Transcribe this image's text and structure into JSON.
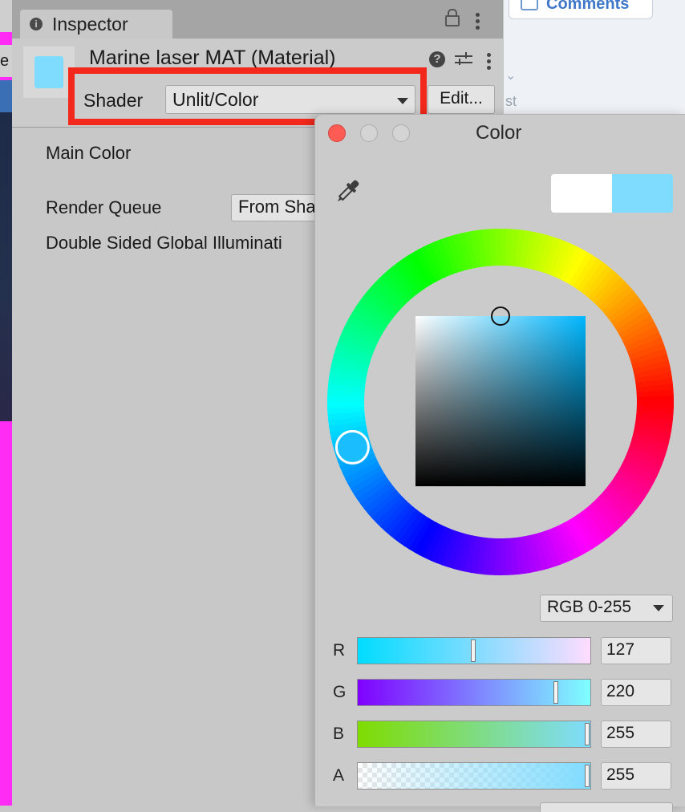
{
  "background_app": {
    "comments_label": "Comments",
    "truncated_text": "st"
  },
  "scene_strip": {
    "truncated_label": "e"
  },
  "inspector": {
    "tab_label": "Inspector",
    "material_title": "Marine laser MAT (Material)",
    "shader_label": "Shader",
    "shader_value": "Unlit/Color",
    "edit_button": "Edit...",
    "help_glyph": "?",
    "properties": {
      "main_color": "Main Color",
      "render_queue": "Render Queue",
      "render_queue_value": "From Sha",
      "double_sided_gi": "Double Sided Global Illuminati"
    },
    "highlight_color": "#f2281c",
    "material_swatch_color": "#80dcff"
  },
  "color_picker": {
    "title": "Color",
    "old_color": "#ffffff",
    "new_color": "#80dcff",
    "mode": "RGB 0-255",
    "hue_degrees": 197,
    "saturation": 0.5,
    "brightness": 1.0,
    "channels": [
      {
        "label": "R",
        "value": "127",
        "fraction": 0.498
      },
      {
        "label": "G",
        "value": "220",
        "fraction": 0.863
      },
      {
        "label": "B",
        "value": "255",
        "fraction": 1.0
      },
      {
        "label": "A",
        "value": "255",
        "fraction": 1.0
      }
    ]
  }
}
